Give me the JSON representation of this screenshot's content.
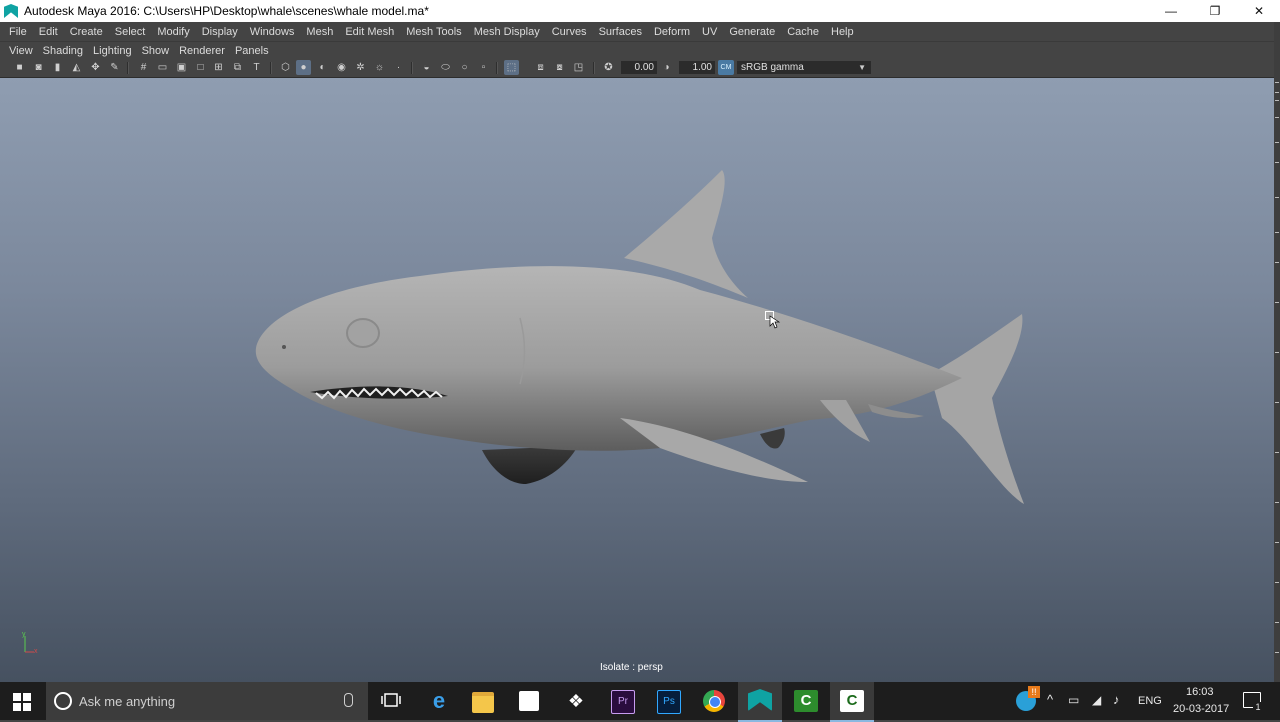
{
  "window": {
    "title": "Autodesk Maya 2016: C:\\Users\\HP\\Desktop\\whale\\scenes\\whale model.ma*",
    "controls": {
      "minimize": "—",
      "maximize": "❐",
      "close": "✕"
    }
  },
  "main_menu": [
    "File",
    "Edit",
    "Create",
    "Select",
    "Modify",
    "Display",
    "Windows",
    "Mesh",
    "Edit Mesh",
    "Mesh Tools",
    "Mesh Display",
    "Curves",
    "Surfaces",
    "Deform",
    "UV",
    "Generate",
    "Cache",
    "Help"
  ],
  "panel_menu": [
    "View",
    "Shading",
    "Lighting",
    "Show",
    "Renderer",
    "Panels"
  ],
  "toolbar": {
    "exposure_value": "0.00",
    "gamma_value": "1.00",
    "color_management": "sRGB gamma",
    "color_management_toggle_label": "CM"
  },
  "viewport": {
    "camera_label": "Isolate : persp",
    "axis_labels": {
      "x": "x",
      "y": "y"
    },
    "background_top": "#8f9db1",
    "background_bottom": "#465160"
  },
  "taskbar": {
    "search_placeholder": "Ask me anything",
    "language": "ENG",
    "time": "16:03",
    "date": "20-03-2017",
    "notification_count": "1",
    "apps": [
      "task-view",
      "edge",
      "file-explorer",
      "store",
      "dropbox",
      "premiere",
      "photoshop",
      "chrome",
      "maya",
      "camtasia-recorder",
      "camtasia-studio"
    ]
  },
  "colors": {
    "maya_ui": "#444444",
    "taskbar": "#1d1d1d",
    "accent": "#4a7aa3"
  }
}
